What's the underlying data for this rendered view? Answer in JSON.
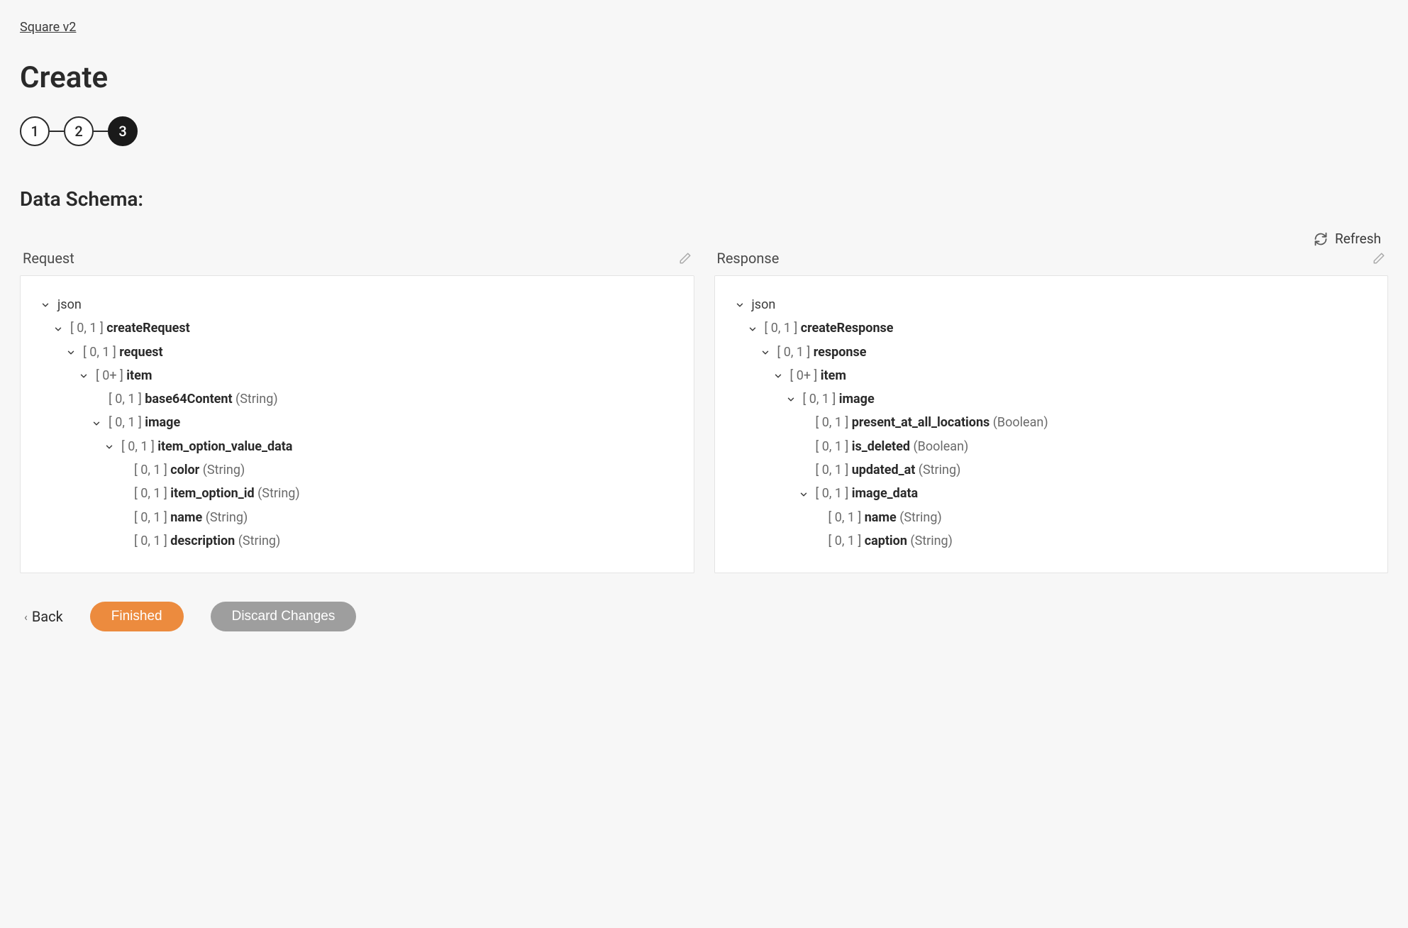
{
  "breadcrumb": "Square v2",
  "page_title": "Create",
  "stepper": {
    "steps": [
      "1",
      "2",
      "3"
    ],
    "active_index": 2
  },
  "section_title": "Data Schema:",
  "refresh_label": "Refresh",
  "panels": {
    "request": {
      "header": "Request",
      "tree": [
        {
          "depth": 0,
          "expandable": true,
          "label": "json"
        },
        {
          "depth": 1,
          "expandable": true,
          "cardinality": "[ 0, 1 ]",
          "name": "createRequest"
        },
        {
          "depth": 2,
          "expandable": true,
          "cardinality": "[ 0, 1 ]",
          "name": "request"
        },
        {
          "depth": 3,
          "expandable": true,
          "cardinality": "[ 0+ ]",
          "name": "item"
        },
        {
          "depth": 4,
          "expandable": false,
          "cardinality": "[ 0, 1 ]",
          "name": "base64Content",
          "type": "(String)"
        },
        {
          "depth": 4,
          "expandable": true,
          "cardinality": "[ 0, 1 ]",
          "name": "image"
        },
        {
          "depth": 5,
          "expandable": true,
          "cardinality": "[ 0, 1 ]",
          "name": "item_option_value_data"
        },
        {
          "depth": 6,
          "expandable": false,
          "cardinality": "[ 0, 1 ]",
          "name": "color",
          "type": "(String)"
        },
        {
          "depth": 6,
          "expandable": false,
          "cardinality": "[ 0, 1 ]",
          "name": "item_option_id",
          "type": "(String)"
        },
        {
          "depth": 6,
          "expandable": false,
          "cardinality": "[ 0, 1 ]",
          "name": "name",
          "type": "(String)"
        },
        {
          "depth": 6,
          "expandable": false,
          "cardinality": "[ 0, 1 ]",
          "name": "description",
          "type": "(String)"
        }
      ]
    },
    "response": {
      "header": "Response",
      "tree": [
        {
          "depth": 0,
          "expandable": true,
          "label": "json"
        },
        {
          "depth": 1,
          "expandable": true,
          "cardinality": "[ 0, 1 ]",
          "name": "createResponse"
        },
        {
          "depth": 2,
          "expandable": true,
          "cardinality": "[ 0, 1 ]",
          "name": "response"
        },
        {
          "depth": 3,
          "expandable": true,
          "cardinality": "[ 0+ ]",
          "name": "item"
        },
        {
          "depth": 4,
          "expandable": true,
          "cardinality": "[ 0, 1 ]",
          "name": "image"
        },
        {
          "depth": 5,
          "expandable": false,
          "cardinality": "[ 0, 1 ]",
          "name": "present_at_all_locations",
          "type": "(Boolean)"
        },
        {
          "depth": 5,
          "expandable": false,
          "cardinality": "[ 0, 1 ]",
          "name": "is_deleted",
          "type": "(Boolean)"
        },
        {
          "depth": 5,
          "expandable": false,
          "cardinality": "[ 0, 1 ]",
          "name": "updated_at",
          "type": "(String)"
        },
        {
          "depth": 5,
          "expandable": true,
          "cardinality": "[ 0, 1 ]",
          "name": "image_data"
        },
        {
          "depth": 6,
          "expandable": false,
          "cardinality": "[ 0, 1 ]",
          "name": "name",
          "type": "(String)"
        },
        {
          "depth": 6,
          "expandable": false,
          "cardinality": "[ 0, 1 ]",
          "name": "caption",
          "type": "(String)"
        }
      ]
    }
  },
  "footer": {
    "back_label": "Back",
    "finished_label": "Finished",
    "discard_label": "Discard Changes"
  }
}
